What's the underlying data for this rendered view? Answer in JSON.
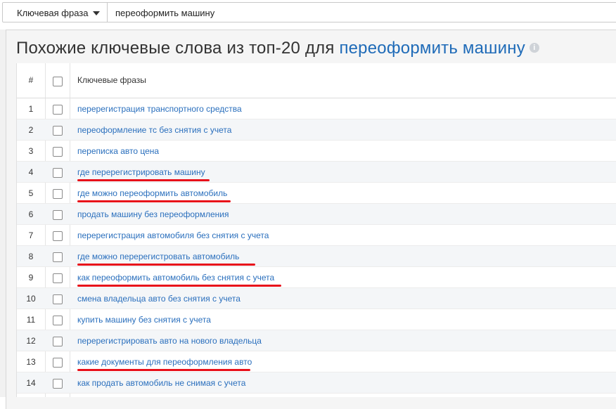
{
  "search": {
    "dropdown_label": "Ключевая фраза",
    "query": "переоформить машину"
  },
  "heading": {
    "prefix": "Похожие ключевые слова из топ-20 для",
    "keyword": "переоформить машину",
    "info_icon": "info-icon"
  },
  "table": {
    "columns": [
      "#",
      "",
      "Ключевые фразы"
    ],
    "rows": [
      {
        "n": "1",
        "phrase": "перерегистрация транспортного средства"
      },
      {
        "n": "2",
        "phrase": "переоформление тс без снятия с учета"
      },
      {
        "n": "3",
        "phrase": "переписка авто цена"
      },
      {
        "n": "4",
        "phrase": "где перерегистрировать машину"
      },
      {
        "n": "5",
        "phrase": "где можно переоформить автомобиль"
      },
      {
        "n": "6",
        "phrase": "продать машину без переоформления"
      },
      {
        "n": "7",
        "phrase": "перерегистрация автомобиля без снятия с учета"
      },
      {
        "n": "8",
        "phrase": "где можно перерегистровать автомобиль"
      },
      {
        "n": "9",
        "phrase": "как переоформить автомобиль без снятия с учета"
      },
      {
        "n": "10",
        "phrase": "смена владельца авто без снятия с учета"
      },
      {
        "n": "11",
        "phrase": "купить машину без снятия с учета"
      },
      {
        "n": "12",
        "phrase": "перерегистрировать авто на нового владельца"
      },
      {
        "n": "13",
        "phrase": "какие документы для переоформления авто"
      },
      {
        "n": "14",
        "phrase": "как продать автомобиль не снимая с учета"
      }
    ]
  },
  "colors": {
    "link": "#2a6fbd",
    "heading_keyword": "#1f6bb8",
    "underline_annotation": "#e8101a"
  }
}
